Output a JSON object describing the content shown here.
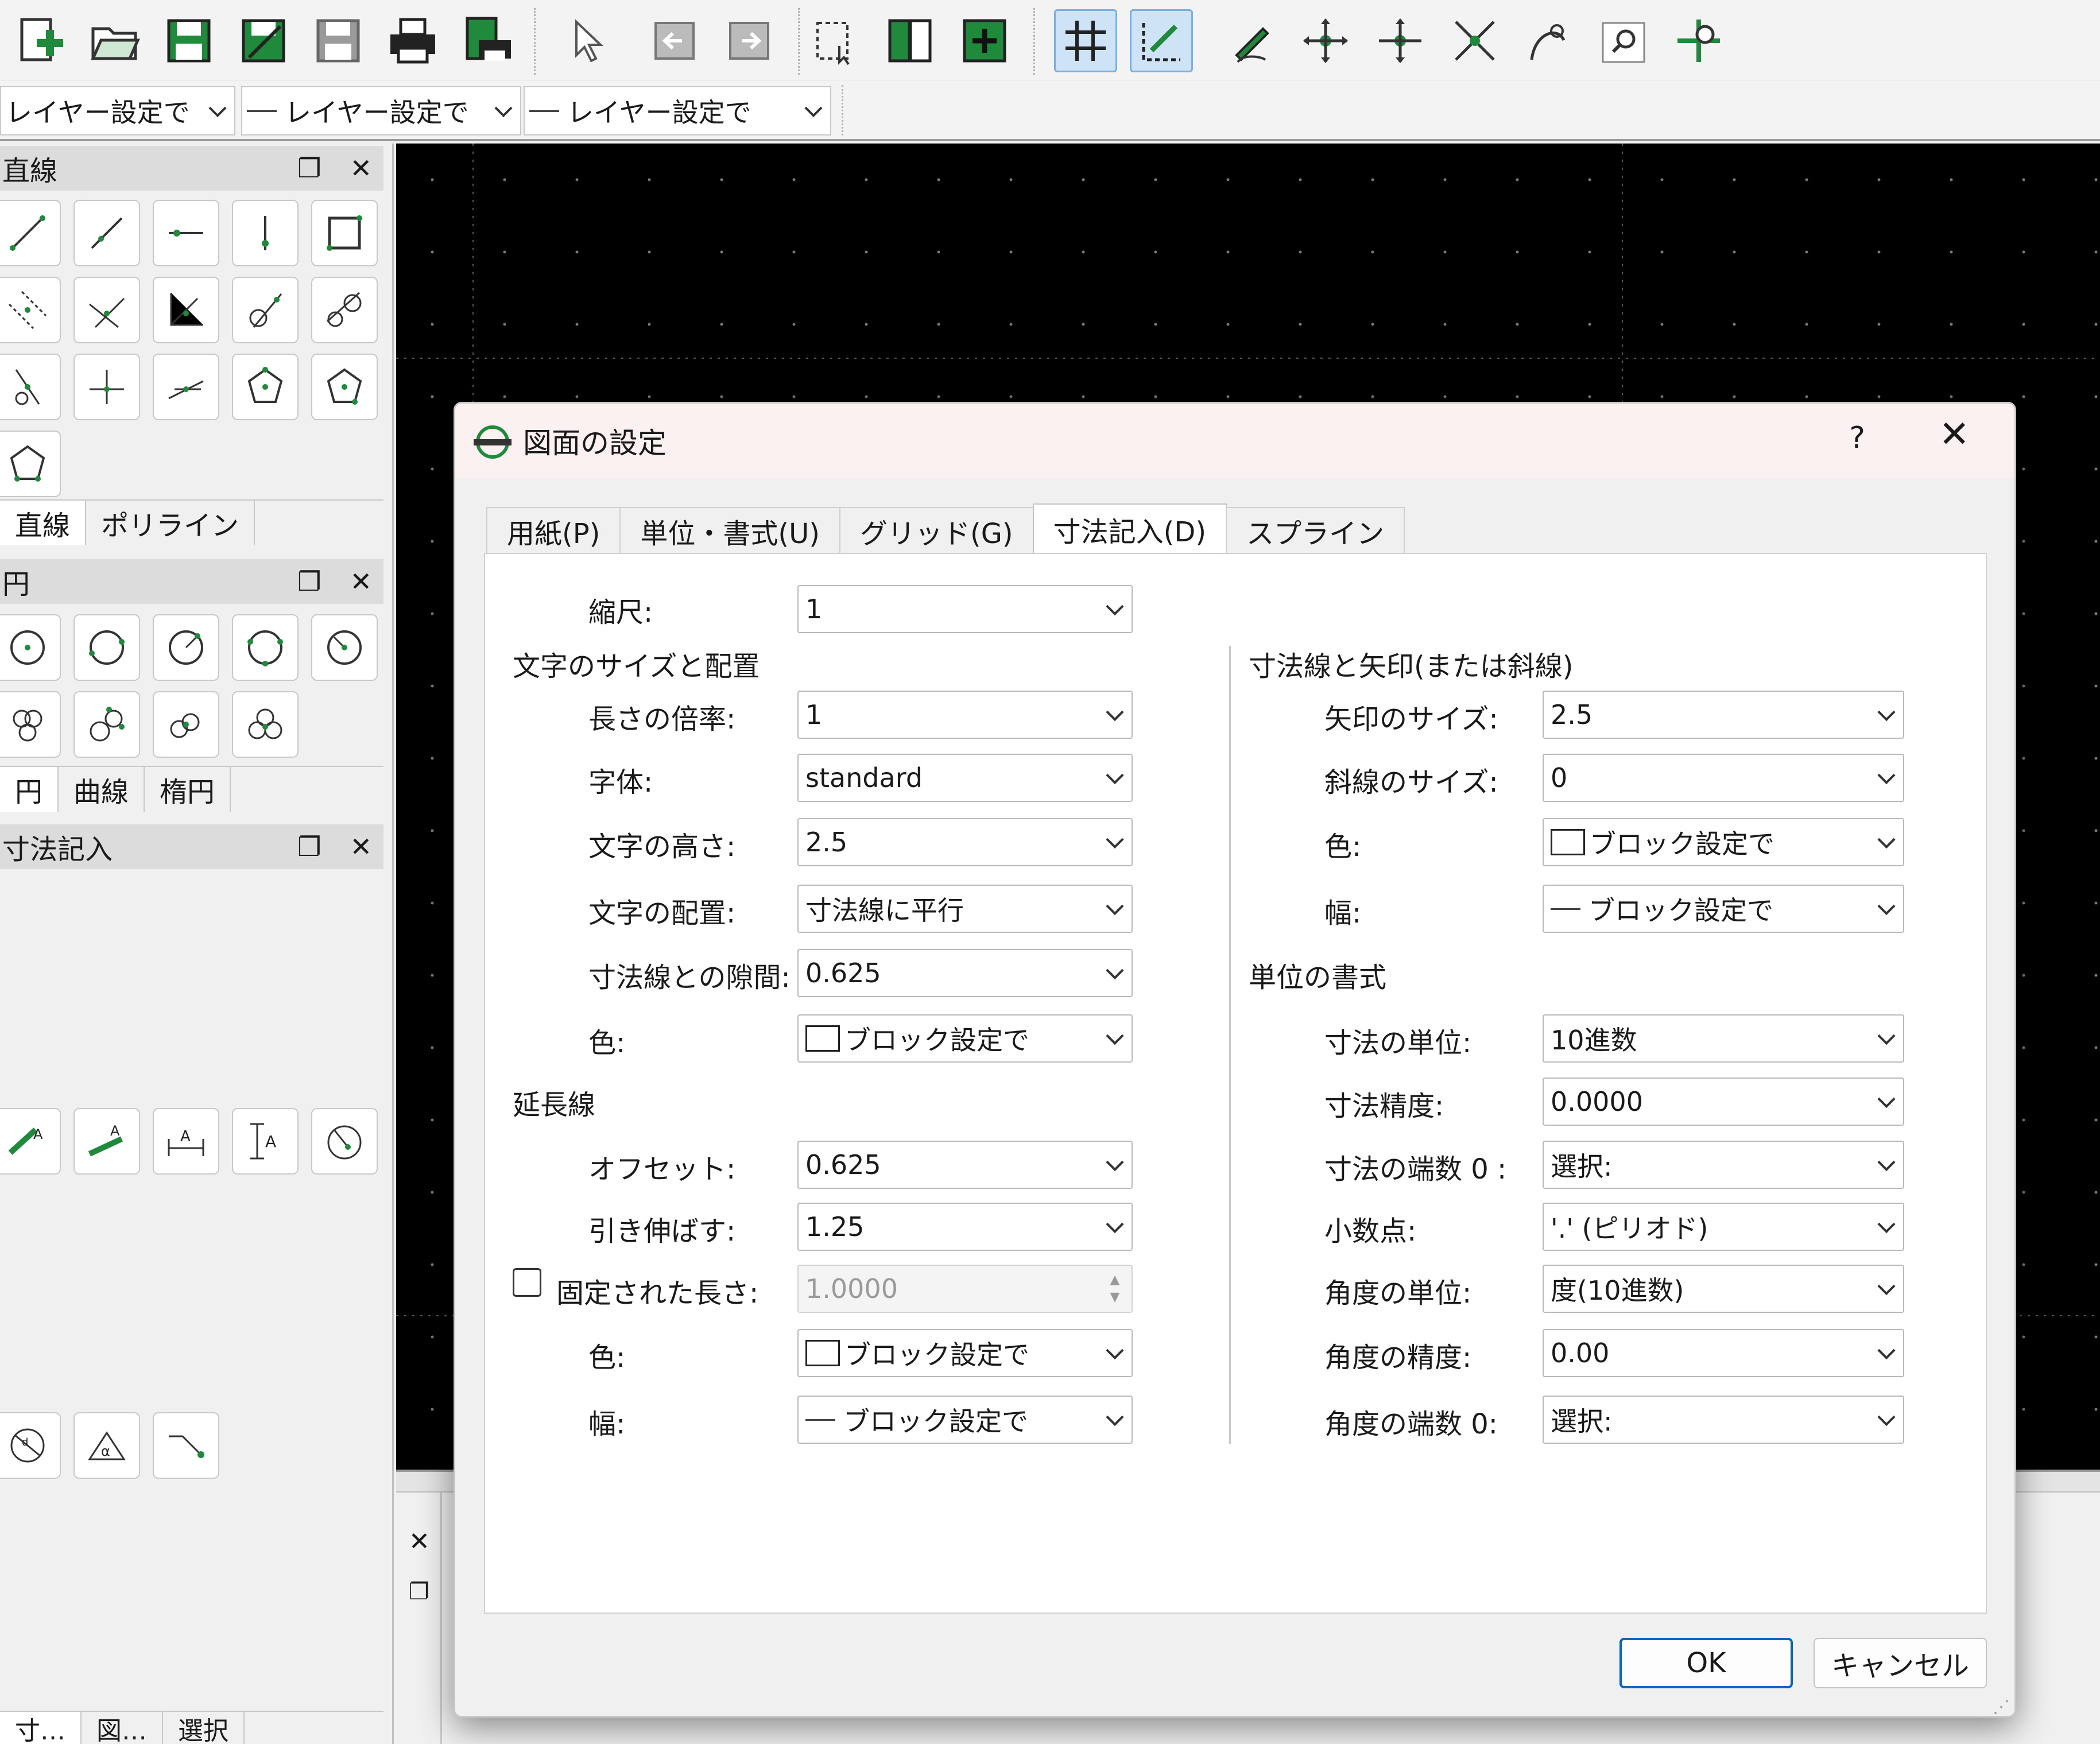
{
  "toolbar": {
    "buttons": [
      "new-file-icon",
      "open-folder-icon",
      "save-icon",
      "save-as-icon",
      "save-all-icon",
      "print-icon",
      "print-preview-icon",
      "select-pointer-icon",
      "back-icon",
      "forward-icon",
      "select-window-icon",
      "layer-block-icon",
      "add-block-icon",
      "grid-icon",
      "snap-draw-icon",
      "pen-icon",
      "rotate-icon",
      "move-icon",
      "scale-icon",
      "stretch-icon",
      "arc-icon",
      "zoom-window-icon",
      "zoom-pan-icon"
    ]
  },
  "layer_toolbar": {
    "combo1": "レイヤー設定で",
    "combo2": "レイヤー設定で",
    "combo3": "レイヤー設定で"
  },
  "left_panel": {
    "dock_line": {
      "title": "直線",
      "tabs": [
        "直線",
        "ポリライン"
      ]
    },
    "dock_circle": {
      "title": "円",
      "tabs": [
        "円",
        "曲線",
        "楕円"
      ]
    },
    "dock_dimension": {
      "title": "寸法記入"
    },
    "bottom_tabs": [
      "寸…",
      "図…",
      "選択"
    ]
  },
  "dialog": {
    "title": "図面の設定",
    "help": "?",
    "tabs": [
      "用紙(P)",
      "単位・書式(U)",
      "グリッド(G)",
      "寸法記入(D)",
      "スプライン"
    ],
    "active_tab": "寸法記入(D)",
    "scale": {
      "label": "縮尺:",
      "value": "1"
    },
    "text_section": {
      "heading": "文字のサイズと配置",
      "length_factor": {
        "label": "長さの倍率:",
        "value": "1"
      },
      "font": {
        "label": "字体:",
        "value": "standard"
      },
      "text_height": {
        "label": "文字の高さ:",
        "value": "2.5"
      },
      "text_align": {
        "label": "文字の配置:",
        "value": "寸法線に平行"
      },
      "gap": {
        "label": "寸法線との隙間:",
        "value": "0.625"
      },
      "color": {
        "label": "色:",
        "value": "ブロック設定で"
      }
    },
    "extension_section": {
      "heading": "延長線",
      "offset": {
        "label": "オフセット:",
        "value": "0.625"
      },
      "extend": {
        "label": "引き伸ばす:",
        "value": "1.25"
      },
      "fixed_length": {
        "label": "固定された長さ:",
        "value": "1.0000",
        "checked": false
      },
      "color": {
        "label": "色:",
        "value": "ブロック設定で"
      },
      "width": {
        "label": "幅:",
        "value": "ブロック設定で"
      }
    },
    "arrow_section": {
      "heading": "寸法線と矢印(または斜線)",
      "arrow_size": {
        "label": "矢印のサイズ:",
        "value": "2.5"
      },
      "tick_size": {
        "label": "斜線のサイズ:",
        "value": "0"
      },
      "color": {
        "label": "色:",
        "value": "ブロック設定で"
      },
      "width": {
        "label": "幅:",
        "value": "ブロック設定で"
      }
    },
    "units_section": {
      "heading": "単位の書式",
      "dim_unit": {
        "label": "寸法の単位:",
        "value": "10進数"
      },
      "dim_precision": {
        "label": "寸法精度:",
        "value": "0.0000"
      },
      "dim_zeros": {
        "label": "寸法の端数 0 :",
        "value": "選択:"
      },
      "decimal_point": {
        "label": "小数点:",
        "value": "'.' (ピリオド)"
      },
      "angle_unit": {
        "label": "角度の単位:",
        "value": "度(10進数)"
      },
      "angle_precision": {
        "label": "角度の精度:",
        "value": "0.00"
      },
      "angle_zeros": {
        "label": "角度の端数 0:",
        "value": "選択:"
      }
    },
    "ok": "OK",
    "cancel": "キャンセル"
  },
  "colors": {
    "accent": "#0067c0",
    "icon_green": "#1f8a3c",
    "canvas": "#000000"
  }
}
